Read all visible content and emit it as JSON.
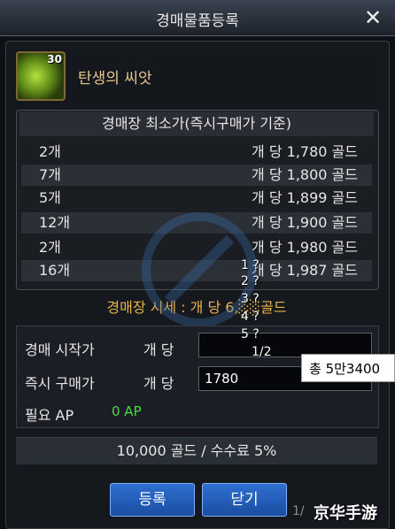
{
  "window": {
    "title": "경매물품등록",
    "close_glyph": "✕"
  },
  "item": {
    "count": "30",
    "name": "탄생의 씨앗",
    "icon": "seed-item-icon"
  },
  "price_table": {
    "header": "경매장 최소가(즉시구매가 기준)",
    "rows": [
      {
        "qty": "2개",
        "price": "개 당 1,780 골드"
      },
      {
        "qty": "7개",
        "price": "개 당 1,800 골드"
      },
      {
        "qty": "5개",
        "price": "개 당 1,899 골드"
      },
      {
        "qty": "12개",
        "price": "개 당 1,900 골드"
      },
      {
        "qty": "2개",
        "price": "개 당 1,980 골드"
      },
      {
        "qty": "16개",
        "price": "개 당 1,987 골드"
      }
    ],
    "market_line": "경매장 시세 : 개 당 6,░░골드"
  },
  "form": {
    "start_label": "경매 시작가",
    "start_unit": "개 당",
    "start_value": "",
    "buyout_label": "즉시 구매가",
    "buyout_unit": "개 당",
    "buyout_value": "1780",
    "ap_label": "필요 AP",
    "ap_value": "0 AP",
    "total_text": "총 5만3400"
  },
  "overlay": {
    "lines": [
      "1 ?",
      "2 ?",
      "3 ?",
      "4 ?",
      "5 ?",
      "1/2"
    ]
  },
  "fee": "10,000 골드 / 수수료 5%",
  "buttons": {
    "register": "등록",
    "close": "닫기"
  },
  "footer": {
    "page": "1/",
    "logo": "京华手游"
  },
  "colors": {
    "accent_gold": "#e9b34a",
    "ap_green": "#4ad844",
    "button_blue": "#2f6fd0"
  }
}
